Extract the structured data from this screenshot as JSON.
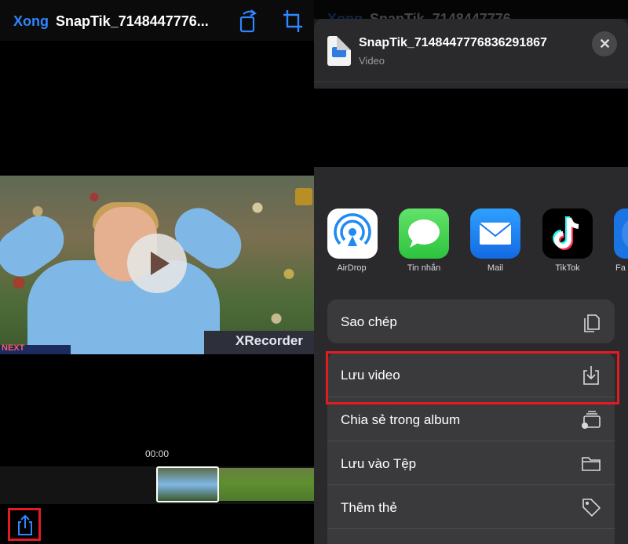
{
  "left": {
    "nav": {
      "done_label": "Xong",
      "title": "SnapTik_7148447776..."
    },
    "video": {
      "ad_right_text": "XRecorder",
      "ad_left_text": "NEXT"
    },
    "timecode": "00:00",
    "highlight_color": "#e31c23"
  },
  "right": {
    "bg_nav": {
      "done_label": "Xong",
      "title": "SnapTik_7148447776"
    },
    "sheet": {
      "file_title": "SnapTik_7148447776836291867",
      "file_subtitle": "Video",
      "apps": [
        {
          "label": "AirDrop",
          "icon": "airdrop-icon"
        },
        {
          "label": "Tin nhắn",
          "icon": "messages-icon"
        },
        {
          "label": "Mail",
          "icon": "mail-icon"
        },
        {
          "label": "TikTok",
          "icon": "tiktok-icon"
        },
        {
          "label": "Fa",
          "icon": "facebook-icon"
        }
      ],
      "actions": [
        {
          "label": "Sao chép",
          "icon": "copy-icon"
        },
        {
          "label": "Lưu video",
          "icon": "save-video-icon"
        },
        {
          "label": "Chia sẻ trong album",
          "icon": "shared-album-icon"
        },
        {
          "label": "Lưu vào Tệp",
          "icon": "folder-icon"
        },
        {
          "label": "Thêm thẻ",
          "icon": "tag-icon"
        }
      ]
    }
  },
  "colors": {
    "accent": "#2f86ff",
    "highlight": "#e31c23",
    "sheet_bg": "#2a2a2c",
    "row_bg": "#3a3a3c"
  }
}
